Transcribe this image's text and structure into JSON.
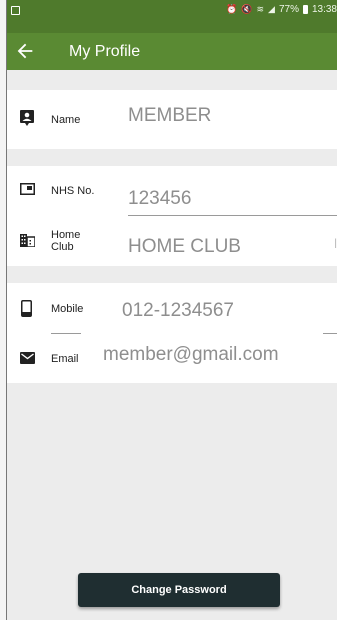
{
  "status_bar": {
    "time": "13:38",
    "battery": "77%",
    "icons": [
      "image-icon",
      "alarm-icon",
      "mute-icon",
      "wifi-icon",
      "signal-icon",
      "battery-icon"
    ]
  },
  "app_bar": {
    "title": "My Profile",
    "back_icon": "arrow-left-icon",
    "color": "#5a8a33"
  },
  "profile": {
    "name": {
      "label": "Name",
      "value": "MEMBER"
    },
    "nhs": {
      "label": "NHS No.",
      "value": "123456"
    },
    "home_club": {
      "label_line1": "Home",
      "label_line2": "Club",
      "value": "HOME CLUB"
    },
    "mobile": {
      "label": "Mobile",
      "value": "012-1234567"
    },
    "email": {
      "label": "Email",
      "value": "member@gmail.com"
    }
  },
  "actions": {
    "change_password_label": "Change Password"
  }
}
